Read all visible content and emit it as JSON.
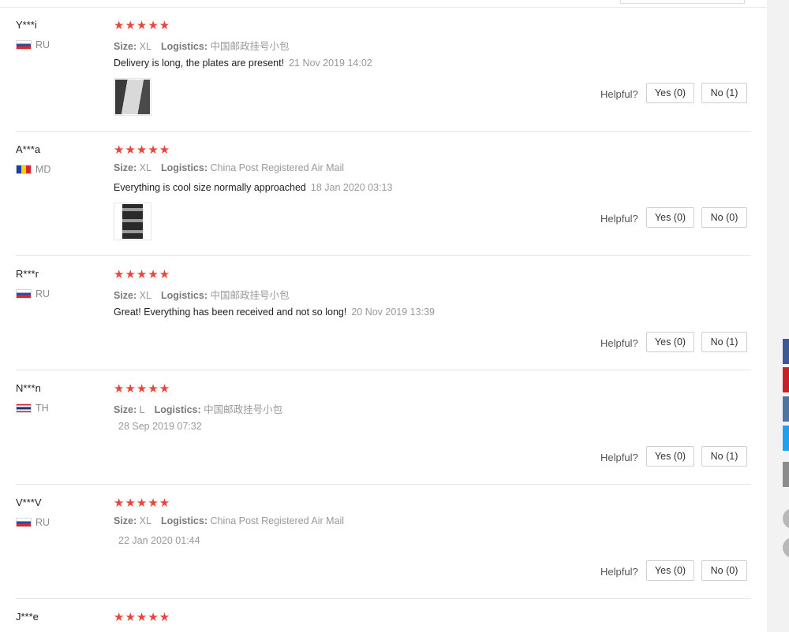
{
  "reviews": [
    {
      "buyer": "Y***i",
      "country": "RU",
      "flag": "ru",
      "stars": "★★★★★",
      "size_label": "Size:",
      "size": "XL",
      "logistics_label": "Logistics:",
      "logistics": "中国邮政挂号小包",
      "text": "Delivery is long, the plates are present!",
      "date": "21 Nov 2019 14:02",
      "helpful": "Helpful?",
      "yes": "Yes (0)",
      "no": "No (1)"
    },
    {
      "buyer": "A***a",
      "country": "MD",
      "flag": "md",
      "stars": "★★★★★",
      "size_label": "Size:",
      "size": "XL",
      "logistics_label": "Logistics:",
      "logistics": "China Post Registered Air Mail",
      "text": "Everything is cool size normally approached",
      "date": "18 Jan 2020 03:13",
      "helpful": "Helpful?",
      "yes": "Yes (0)",
      "no": "No (0)"
    },
    {
      "buyer": "R***r",
      "country": "RU",
      "flag": "ru",
      "stars": "★★★★★",
      "size_label": "Size:",
      "size": "XL",
      "logistics_label": "Logistics:",
      "logistics": "中国邮政挂号小包",
      "text": "Great! Everything has been received and not so long!",
      "date": "20 Nov 2019 13:39",
      "helpful": "Helpful?",
      "yes": "Yes (0)",
      "no": "No (1)"
    },
    {
      "buyer": "N***n",
      "country": "TH",
      "flag": "th",
      "stars": "★★★★★",
      "size_label": "Size:",
      "size": "L",
      "logistics_label": "Logistics:",
      "logistics": "中国邮政挂号小包",
      "text": "",
      "date": "28 Sep 2019 07:32",
      "helpful": "Helpful?",
      "yes": "Yes (0)",
      "no": "No (1)"
    },
    {
      "buyer": "V***V",
      "country": "RU",
      "flag": "ru",
      "stars": "★★★★★",
      "size_label": "Size:",
      "size": "XL",
      "logistics_label": "Logistics:",
      "logistics": "China Post Registered Air Mail",
      "text": "",
      "date": "22 Jan 2020 01:44",
      "helpful": "Helpful?",
      "yes": "Yes (0)",
      "no": "No (0)"
    },
    {
      "buyer": "J***e",
      "stars": "★★★★★"
    }
  ],
  "share_buttons": [
    "facebook-icon",
    "pinterest-icon",
    "vk-icon",
    "twitter-icon",
    "email-icon"
  ],
  "colors": {
    "star": "#e8453c",
    "facebook": "#3b5998",
    "pinterest": "#cb2027",
    "vk": "#4c75a3",
    "twitter": "#1da1f2"
  }
}
